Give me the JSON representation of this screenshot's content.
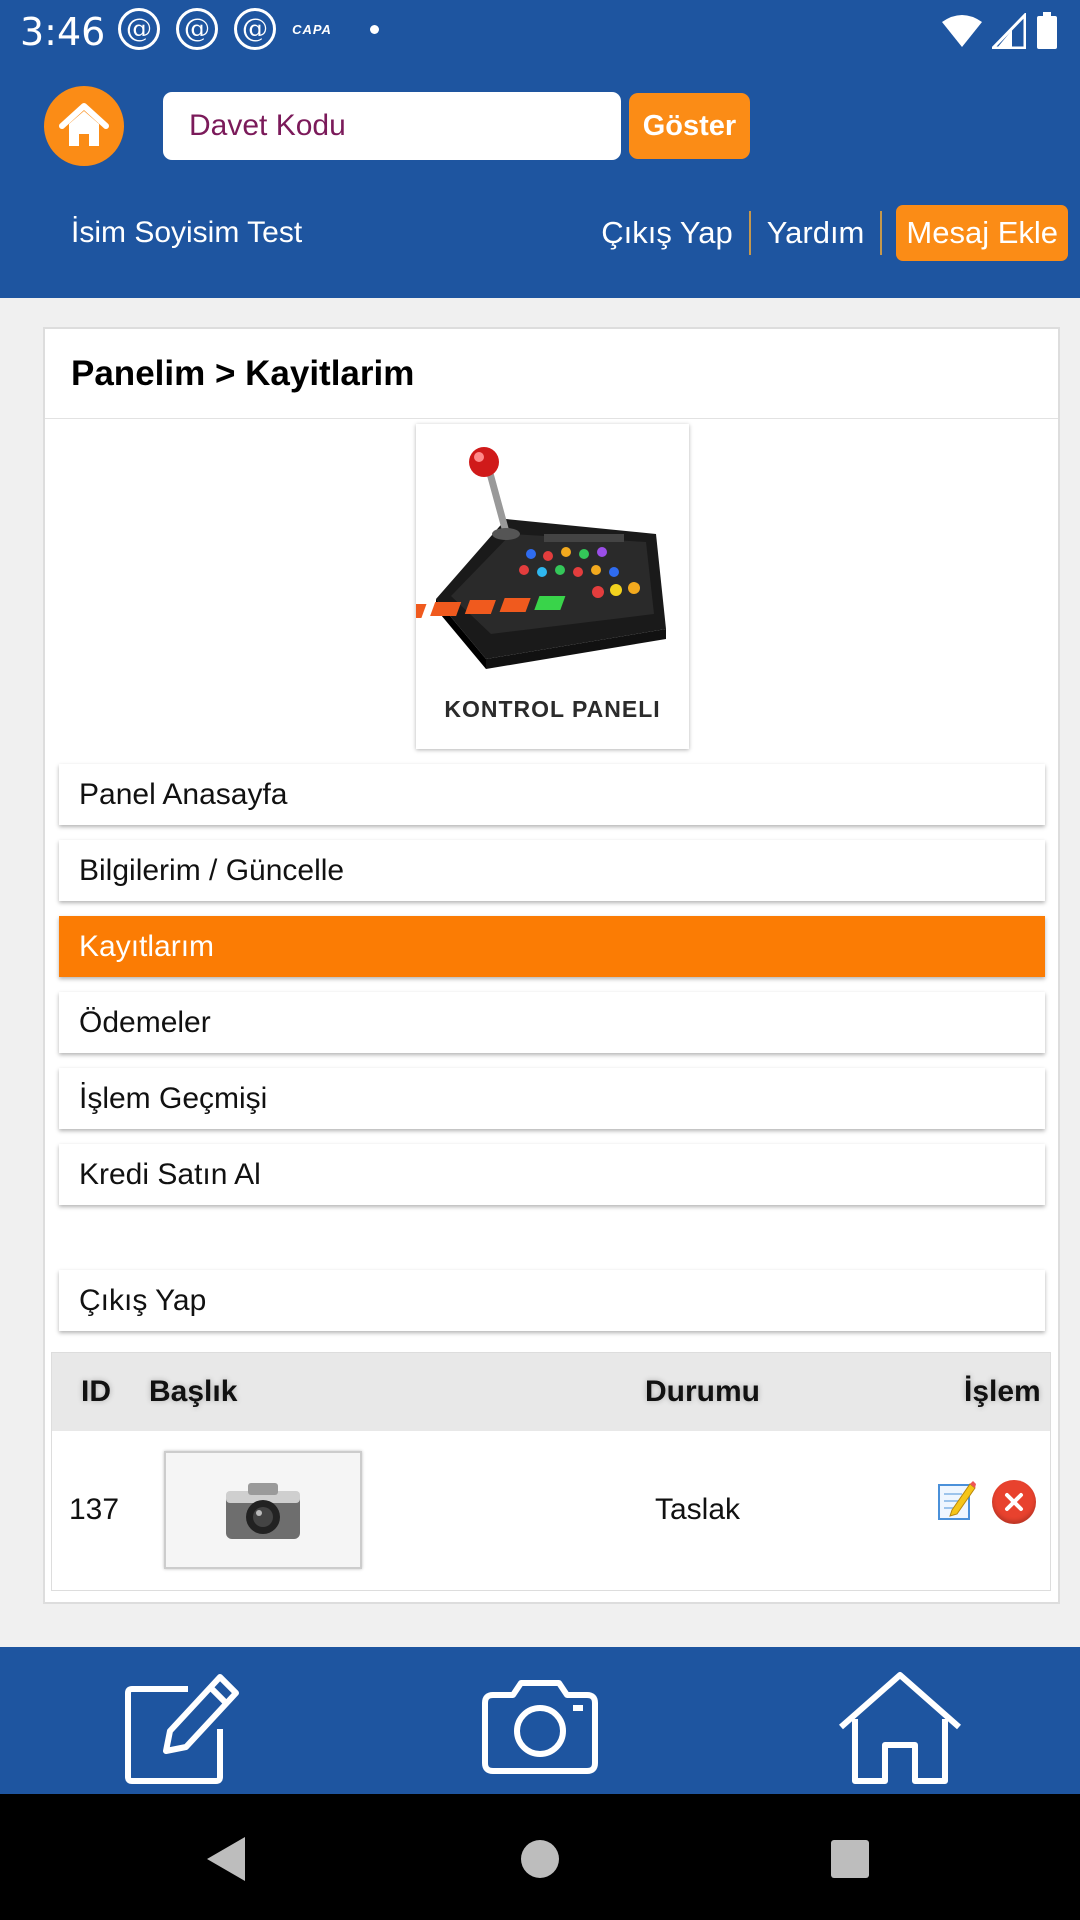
{
  "status": {
    "time": "3:46",
    "notif_at": "@",
    "notif_capa": "CAPA",
    "icons": [
      "wifi-icon",
      "signal-icon",
      "battery-icon"
    ]
  },
  "header": {
    "invite_placeholder": "Davet Kodu",
    "show_label": "Göster",
    "user_name": "İsim Soyisim Test",
    "logout_label": "Çıkış Yap",
    "help_label": "Yardım",
    "add_message_label": "Mesaj Ekle"
  },
  "card": {
    "breadcrumb": "Panelim > Kayitlarim",
    "panel_image_label": "KONTROL PANELI"
  },
  "menu": {
    "items": [
      {
        "label": "Panel Anasayfa",
        "active": false
      },
      {
        "label": "Bilgilerim / Güncelle",
        "active": false
      },
      {
        "label": "Kayıtlarım",
        "active": true
      },
      {
        "label": "Ödemeler",
        "active": false
      },
      {
        "label": "İşlem Geçmişi",
        "active": false
      },
      {
        "label": "Kredi Satın Al",
        "active": false
      }
    ],
    "logout": "Çıkış Yap"
  },
  "table": {
    "columns": [
      "ID",
      "Başlık",
      "Durumu",
      "İşlem"
    ],
    "rows": [
      {
        "id": "137",
        "status": "Taslak"
      }
    ]
  },
  "colors": {
    "primary": "#1e55a0",
    "accent": "#fb8c16",
    "active": "#fb7c04"
  },
  "bottom_bar": [
    "edit-icon",
    "camera-icon",
    "home-icon"
  ]
}
